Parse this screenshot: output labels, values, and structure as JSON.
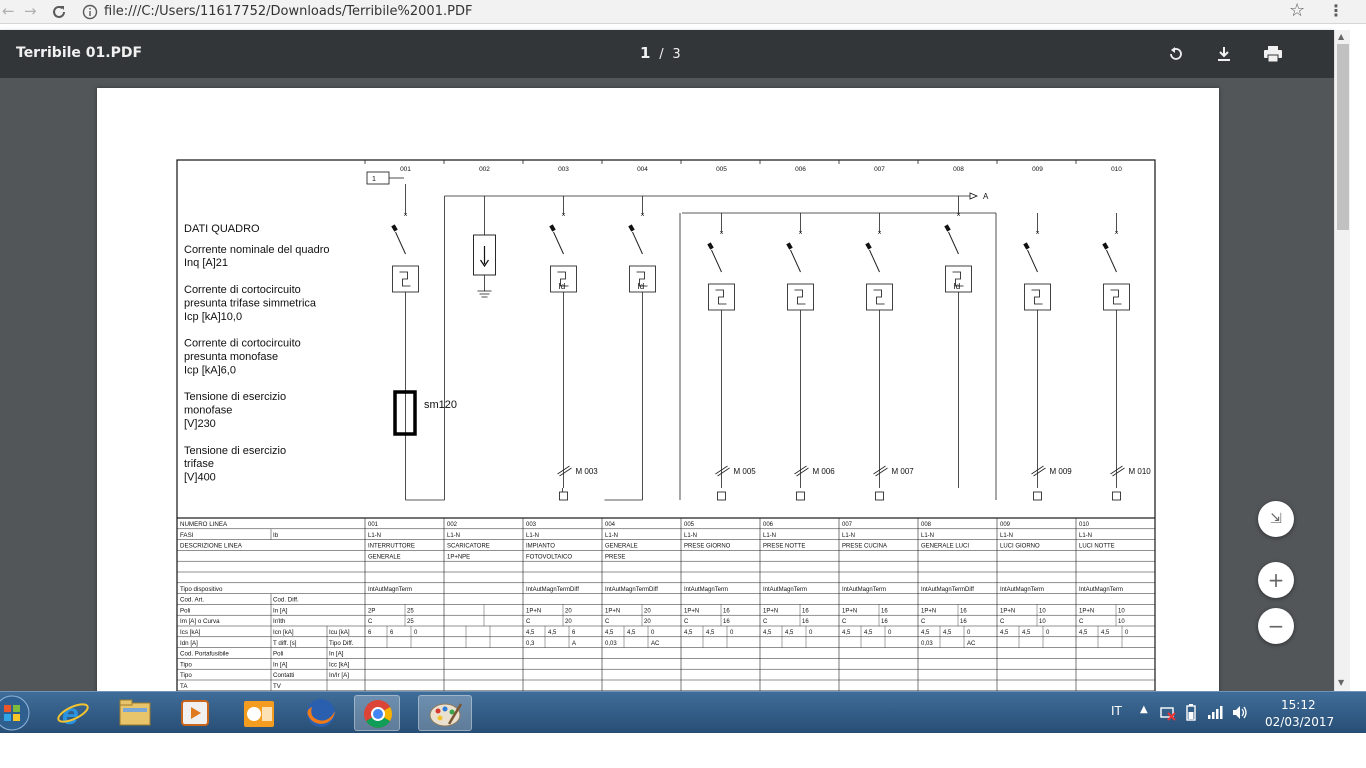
{
  "browser": {
    "url": "file:///C:/Users/11617752/Downloads/Terribile%2001.PDF"
  },
  "pdf": {
    "title": "Terribile 01.PDF",
    "current_page": "1",
    "page_sep": "/",
    "total_pages": "3"
  },
  "schematic": {
    "column_numbers": [
      "001",
      "002",
      "003",
      "004",
      "005",
      "006",
      "007",
      "008",
      "009",
      "010"
    ],
    "dati_quadro": [
      "DATI QUADRO",
      "",
      "Corrente nominale del quadro",
      "Inq [A]21",
      "",
      "Corrente di cortocircuito",
      "presunta trifase simmetrica",
      "Icp [kA]10,0",
      "",
      "Corrente di cortocircuito",
      "presunta monofase",
      "Icp [kA]6,0",
      "",
      "Tensione di esercizio",
      "monofase",
      "[V]230",
      "",
      "Tensione di esercizio",
      "trifase",
      "[V]400"
    ],
    "marker_one": "1",
    "arrow_label": "A",
    "id_label": "Id",
    "overlay_label": "sm120",
    "motor_labels": [
      "",
      "",
      "M 003",
      "",
      "M 005",
      "M 006",
      "M 007",
      "",
      "M 009",
      "M 010"
    ]
  },
  "table": {
    "rows": [
      {
        "h": [
          "NUMERO LINEA"
        ],
        "v": [
          "001",
          "002",
          "003",
          "004",
          "005",
          "006",
          "007",
          "008",
          "009",
          "010"
        ]
      },
      {
        "h": [
          "FASI",
          "Ib"
        ],
        "v": [
          "L1-N",
          "L1-N",
          "L1-N",
          "L1-N",
          "L1-N",
          "L1-N",
          "L1-N",
          "L1-N",
          "L1-N",
          "L1-N"
        ]
      },
      {
        "h": [
          "DESCRIZIONE LINEA"
        ],
        "v": [
          "INTERRUTTORE",
          "SCARICATORE",
          "IMPIANTO",
          "GENERALE",
          "PRESE GIORNO",
          "PRESE NOTTE",
          "PRESE CUCINA",
          "GENERALE LUCI",
          "LUCI GIORNO",
          "LUCI NOTTE"
        ]
      },
      {
        "h": [
          ""
        ],
        "v": [
          "GENERALE",
          "1P+NPE",
          "FOTOVOLTAICO",
          "PRESE",
          "",
          "",
          "",
          "",
          "",
          ""
        ]
      },
      {
        "h": [
          ""
        ],
        "v": [
          "",
          "",
          "",
          "",
          "",
          "",
          "",
          "",
          "",
          ""
        ]
      },
      {
        "h": [
          ""
        ],
        "v": [
          "",
          "",
          "",
          "",
          "",
          "",
          "",
          "",
          "",
          ""
        ]
      },
      {
        "h": [
          "Tipo dispositivo"
        ],
        "v": [
          "IntAutMagnTerm",
          "",
          "IntAutMagnTermDiff",
          "IntAutMagnTermDiff",
          "IntAutMagnTerm",
          "IntAutMagnTerm",
          "IntAutMagnTerm",
          "IntAutMagnTermDiff",
          "IntAutMagnTerm",
          "IntAutMagnTerm"
        ]
      },
      {
        "h": [
          "Cod. Art.",
          "Cod. Diff."
        ],
        "v": [
          "",
          "",
          "",
          "",
          "",
          "",
          "",
          "",
          "",
          ""
        ]
      },
      {
        "h": [
          "Poli",
          "In [A]"
        ],
        "v": [
          [
            "2P",
            "25"
          ],
          [
            "",
            ""
          ],
          [
            "1P+N",
            "20"
          ],
          [
            "1P+N",
            "20"
          ],
          [
            "1P+N",
            "16"
          ],
          [
            "1P+N",
            "16"
          ],
          [
            "1P+N",
            "16"
          ],
          [
            "1P+N",
            "16"
          ],
          [
            "1P+N",
            "10"
          ],
          [
            "1P+N",
            "10"
          ]
        ]
      },
      {
        "h": [
          "Im [A] o Curva",
          "Ir/Ith"
        ],
        "v": [
          [
            "C",
            "25"
          ],
          [
            "",
            ""
          ],
          [
            "C",
            "20"
          ],
          [
            "C",
            "20"
          ],
          [
            "C",
            "16"
          ],
          [
            "C",
            "16"
          ],
          [
            "C",
            "16"
          ],
          [
            "C",
            "16"
          ],
          [
            "C",
            "10"
          ],
          [
            "C",
            "10"
          ]
        ]
      },
      {
        "h": [
          "Ics [kA]",
          "Icn [kA]",
          "Icu [kA]"
        ],
        "v": [
          [
            "6",
            "6",
            "0"
          ],
          [
            "",
            "",
            ""
          ],
          [
            "4,5",
            "4,5",
            "6"
          ],
          [
            "4,5",
            "4,5",
            "0"
          ],
          [
            "4,5",
            "4,5",
            "0"
          ],
          [
            "4,5",
            "4,5",
            "0"
          ],
          [
            "4,5",
            "4,5",
            "0"
          ],
          [
            "4,5",
            "4,5",
            "0"
          ],
          [
            "4,5",
            "4,5",
            "0"
          ],
          [
            "4,5",
            "4,5",
            "0"
          ]
        ]
      },
      {
        "h": [
          "Idn [A]",
          "T diff. [s]",
          "Tipo Diff."
        ],
        "v": [
          [
            "",
            "",
            ""
          ],
          [
            "",
            "",
            ""
          ],
          [
            "0,3",
            "",
            "A"
          ],
          [
            "0,03",
            "",
            "AC"
          ],
          [
            "",
            "",
            ""
          ],
          [
            "",
            "",
            ""
          ],
          [
            "",
            "",
            ""
          ],
          [
            "0,03",
            "",
            "AC"
          ],
          [
            "",
            "",
            ""
          ],
          [
            "",
            "",
            ""
          ]
        ]
      },
      {
        "h": [
          "Cod. Portafusibile",
          "Poli",
          "In [A]"
        ],
        "v": [
          "",
          "",
          "",
          "",
          "",
          "",
          "",
          "",
          "",
          ""
        ]
      },
      {
        "h": [
          "Tipo",
          "In [A]",
          "Icc [kA]"
        ],
        "v": [
          "",
          "",
          "",
          "",
          "",
          "",
          "",
          "",
          "",
          ""
        ]
      },
      {
        "h": [
          "Tipo",
          "Contatti",
          "In/Ir [A]"
        ],
        "v": [
          "",
          "",
          "",
          "",
          "",
          "",
          "",
          "",
          "",
          ""
        ]
      },
      {
        "h": [
          "TA",
          "TV",
          ""
        ],
        "v": [
          "",
          "",
          "",
          "",
          "",
          "",
          "",
          "",
          "",
          ""
        ]
      }
    ]
  },
  "taskbar": {
    "language": "IT",
    "time": "15:12",
    "date": "02/03/2017"
  },
  "icons": {
    "back": "back-arrow-icon",
    "forward": "forward-arrow-icon",
    "reload": "reload-icon",
    "info": "info-icon",
    "star": "bookmark-star-icon",
    "menu": "kebab-menu-icon",
    "rotate": "rotate-icon",
    "download": "download-icon",
    "print": "print-icon",
    "fit": "fit-page-icon",
    "zoom_in": "zoom-in-icon",
    "zoom_out": "zoom-out-icon"
  },
  "colors": {
    "pdf_toolbar": "#323639",
    "viewer_bg": "#525659",
    "taskbar": "#3b6591"
  }
}
